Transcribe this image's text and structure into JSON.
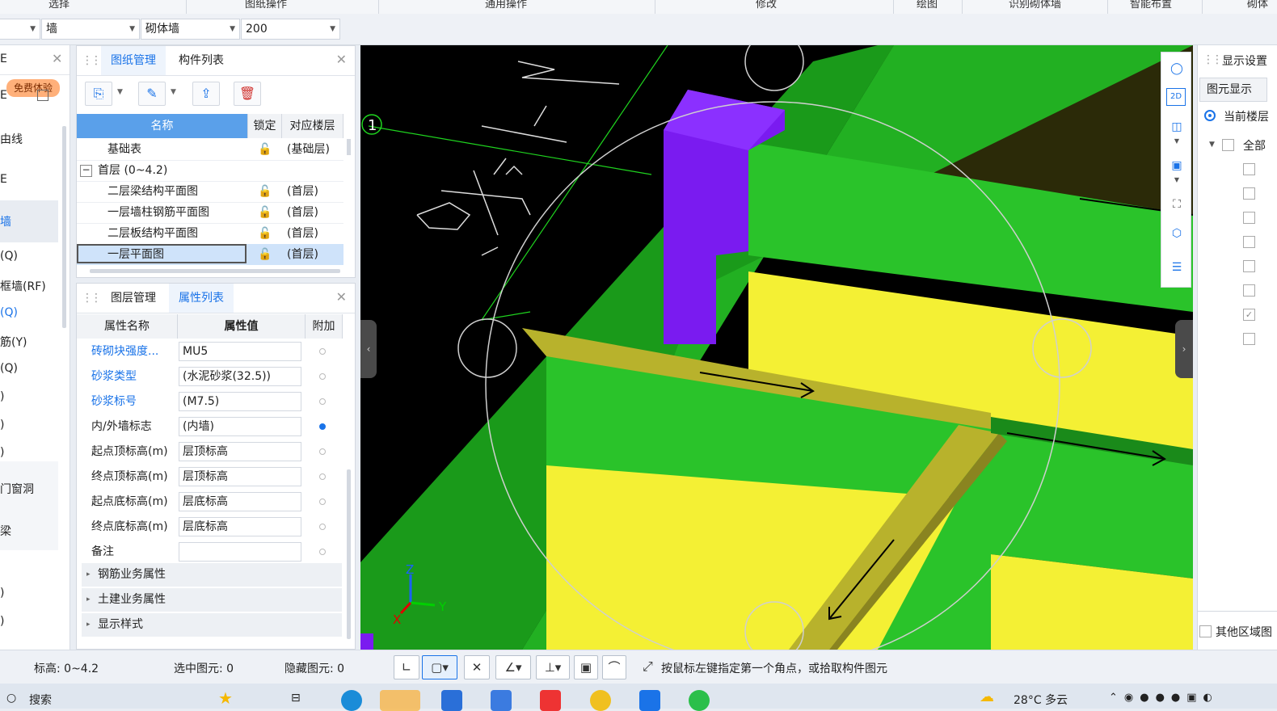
{
  "ribbon": {
    "groups": [
      "选择",
      "图纸操作",
      "通用操作",
      "修改",
      "绘图",
      "识别砌体墙",
      "智能布置",
      "砌体"
    ]
  },
  "toolbar": {
    "combo1": "",
    "combo2": "墙",
    "combo3": "砌体墙",
    "combo4": "200"
  },
  "sidebar": {
    "badge": "免费体验",
    "items": [
      "E",
      "E",
      "由线",
      "E",
      "墙",
      "(Q)",
      "框墙(RF)",
      "(Q)",
      "筋(Y)",
      "(Q)",
      ")",
      ")",
      ")",
      "门窗洞",
      "梁",
      ")",
      ")"
    ]
  },
  "drawing_panel": {
    "tabs": [
      "图纸管理",
      "构件列表"
    ],
    "columns": [
      "名称",
      "锁定",
      "对应楼层"
    ],
    "rows": [
      {
        "name": "基础表",
        "floor": "(基础层)"
      },
      {
        "name": "首层 (0~4.2)",
        "floor": ""
      },
      {
        "name": "二层梁结构平面图",
        "floor": "(首层)"
      },
      {
        "name": "一层墙柱钢筋平面图",
        "floor": "(首层)"
      },
      {
        "name": "二层板结构平面图",
        "floor": "(首层)"
      },
      {
        "name": "一层平面图",
        "floor": "(首层)"
      }
    ],
    "tree_toggle": "−"
  },
  "prop_panel": {
    "tabs": [
      "图层管理",
      "属性列表"
    ],
    "columns": [
      "属性名称",
      "属性值",
      "附加"
    ],
    "rows": [
      {
        "name": "砖砌块强度...",
        "value": "MU5",
        "blue": true
      },
      {
        "name": "砂浆类型",
        "value": "(水泥砂浆(32.5))",
        "blue": true
      },
      {
        "name": "砂浆标号",
        "value": "(M7.5)",
        "blue": true
      },
      {
        "name": "内/外墙标志",
        "value": "(内墙)",
        "blue": false
      },
      {
        "name": "起点顶标高(m)",
        "value": "层顶标高",
        "blue": false
      },
      {
        "name": "终点顶标高(m)",
        "value": "层顶标高",
        "blue": false
      },
      {
        "name": "起点底标高(m)",
        "value": "层底标高",
        "blue": false
      },
      {
        "name": "终点底标高(m)",
        "value": "层底标高",
        "blue": false
      },
      {
        "name": "备注",
        "value": "",
        "blue": false
      }
    ],
    "sections": [
      "钢筋业务属性",
      "土建业务属性",
      "显示样式"
    ]
  },
  "viewport": {
    "axis_label": "1",
    "axes": {
      "x": "X",
      "y": "Y",
      "z": "Z"
    }
  },
  "right_panel": {
    "title": "显示设置",
    "tab": "图元显示",
    "radio": "当前楼层",
    "all": "全部",
    "other": "其他区域图"
  },
  "status": {
    "elev": "标高:  0~4.2",
    "selected": "选中图元:  0",
    "hidden": "隐藏图元:  0",
    "hint": "按鼠标左键指定第一个角点，或拾取构件图元"
  },
  "taskbar": {
    "search": "搜索",
    "weather": "28°C 多云"
  },
  "colors": {
    "accent": "#1a73e8",
    "wall_green": "#2ac32a",
    "floor_yellow": "#f4f034",
    "beam_olive": "#b8b22c",
    "column_purple": "#7a1bf0"
  }
}
